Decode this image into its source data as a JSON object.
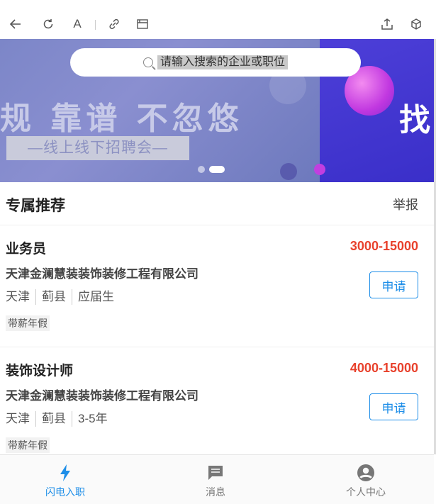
{
  "toolbar": {
    "icons": [
      "back-arrow-icon",
      "refresh-icon",
      "font-icon",
      "link-icon",
      "window-icon",
      "share-icon",
      "cube-icon"
    ],
    "font_glyph": "A"
  },
  "banner": {
    "slogan": "规 靠谱 不忽悠",
    "subtitle": "—线上线下招聘会—",
    "next_slide_text": "找",
    "dots": 2,
    "active_dot": 1
  },
  "search": {
    "placeholder": "请输入搜索的企业或职位"
  },
  "section": {
    "title": "专属推荐",
    "report_label": "举报"
  },
  "jobs": [
    {
      "title": "业务员",
      "salary": "3000-15000",
      "company": "天津金澜慧装装饰装修工程有限公司",
      "city": "天津",
      "district": "蓟县",
      "experience": "应届生",
      "tag": "带薪年假",
      "apply_label": "申请"
    },
    {
      "title": "装饰设计师",
      "salary": "4000-15000",
      "company": "天津金澜慧装装饰装修工程有限公司",
      "city": "天津",
      "district": "蓟县",
      "experience": "3-5年",
      "tag": "带薪年假",
      "apply_label": "申请"
    }
  ],
  "tabbar": {
    "tabs": [
      {
        "label": "闪电入职",
        "icon": "lightning-icon",
        "active": true
      },
      {
        "label": "消息",
        "icon": "message-icon",
        "active": false
      },
      {
        "label": "个人中心",
        "icon": "user-icon",
        "active": false
      }
    ]
  },
  "colors": {
    "accent": "#1e8ee8",
    "salary": "#e8412c"
  }
}
